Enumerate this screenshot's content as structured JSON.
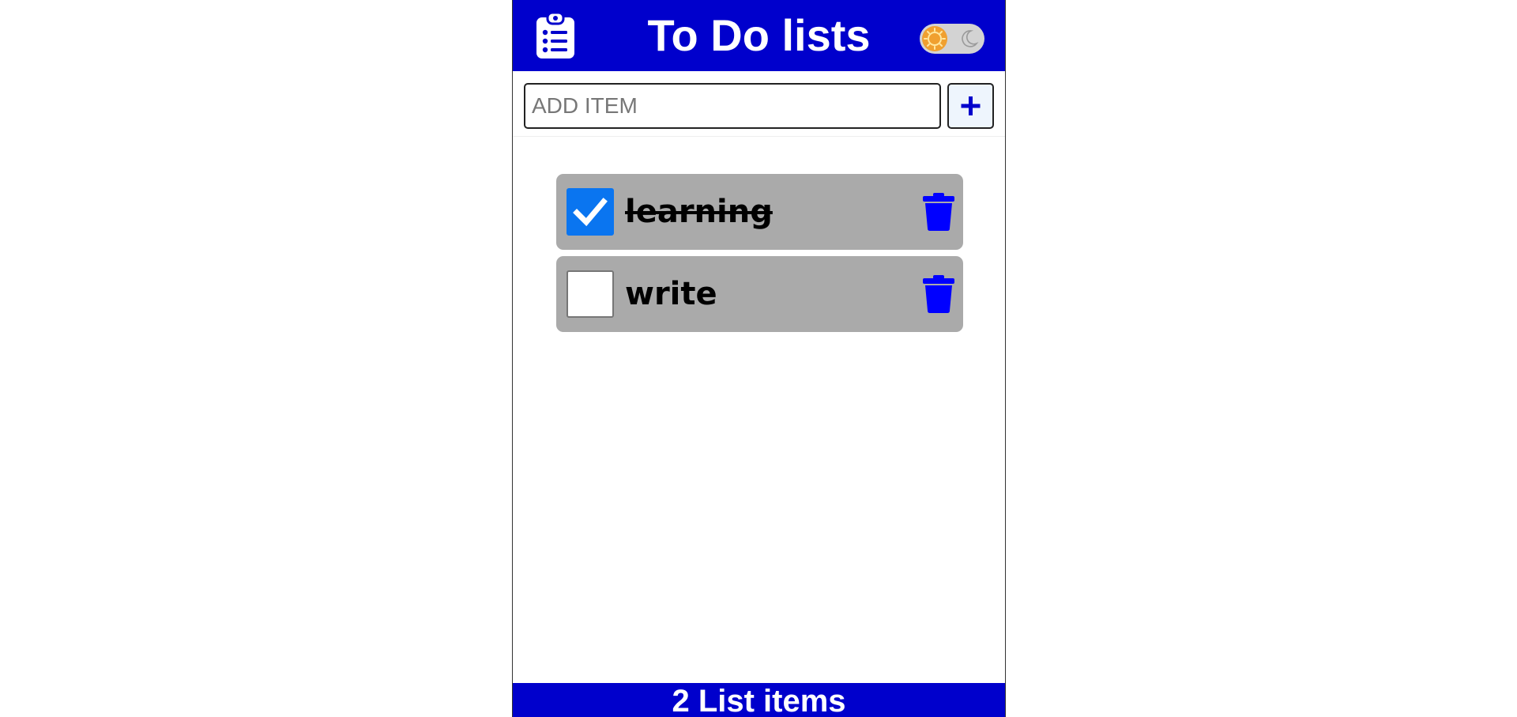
{
  "header": {
    "logo_icon": "clipboard-list-icon",
    "title": "To Do lists",
    "theme_toggle": {
      "state": "light",
      "icons": [
        "sun-icon",
        "moon-icon"
      ]
    }
  },
  "add_item": {
    "placeholder": "ADD ITEM",
    "value": "",
    "button_icon": "plus-icon"
  },
  "items": [
    {
      "label": "learning",
      "checked": true,
      "delete_icon": "trash-icon"
    },
    {
      "label": "write",
      "checked": false,
      "delete_icon": "trash-icon"
    }
  ],
  "footer": {
    "count_text": "2 List items"
  },
  "colors": {
    "primary": "#0000cc",
    "item_background": "#aaaaaa",
    "checkbox_checked": "#0a75f0",
    "trash_icon": "#0000ff",
    "toggle_knob": "#f0a030"
  }
}
